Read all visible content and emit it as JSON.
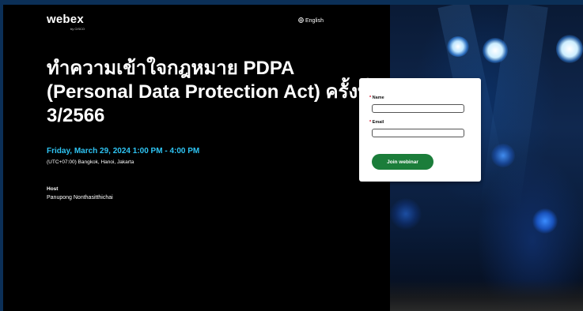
{
  "brand": {
    "name": "webex",
    "sub": "by CISCO"
  },
  "language": {
    "label": "English",
    "icon": "globe-icon"
  },
  "event": {
    "title": "ทำความเข้าใจกฎหมาย PDPA (Personal Data Protection Act) ครั้งที่ 3/2566",
    "datetime": "Friday, March 29, 2024 1:00 PM - 4:00 PM",
    "timezone": "(UTC+07:00) Bangkok, Hanoi, Jakarta"
  },
  "host": {
    "label": "Host",
    "name": "Panupong Nonthasitthichai"
  },
  "form": {
    "name_label": "Name",
    "name_value": "",
    "email_label": "Email",
    "email_value": "",
    "required_marker": "*",
    "submit_label": "Join webinar"
  },
  "colors": {
    "accent_date": "#2ec4f3",
    "button": "#1b7d3a",
    "background": "#000000"
  }
}
